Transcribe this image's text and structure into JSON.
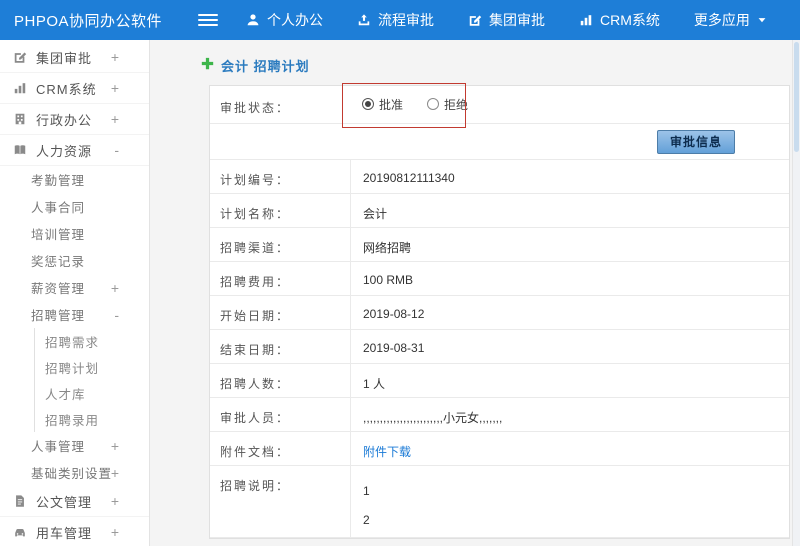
{
  "navbar": {
    "brand": "PHPOA协同办公软件",
    "menu": [
      {
        "label": "个人办公",
        "icon": "person-icon",
        "name": "personal-office"
      },
      {
        "label": "流程审批",
        "icon": "flow-icon",
        "name": "workflow-approval"
      },
      {
        "label": "集团审批",
        "icon": "edit-icon",
        "name": "group-approval"
      },
      {
        "label": "CRM系统",
        "icon": "chart-icon",
        "name": "crm-system"
      },
      {
        "label": "更多应用",
        "icon": "caret-down-icon",
        "icon_position": "after",
        "name": "more-apps"
      }
    ]
  },
  "sidebar": {
    "items": [
      {
        "label": "集团审批",
        "toggle": "+",
        "level": 0,
        "icon": "edit-icon",
        "name": "group-approval"
      },
      {
        "label": "CRM系统",
        "toggle": "+",
        "level": 0,
        "icon": "chart-icon",
        "name": "crm-system"
      },
      {
        "label": "行政办公",
        "toggle": "+",
        "level": 0,
        "icon": "building-icon",
        "name": "admin-office"
      },
      {
        "label": "人力资源",
        "toggle": "-",
        "level": 0,
        "icon": "book-icon",
        "name": "human-resources"
      },
      {
        "label": "考勤管理",
        "toggle": "",
        "level": 1,
        "name": "attendance-mgmt"
      },
      {
        "label": "人事合同",
        "toggle": "",
        "level": 1,
        "name": "hr-contracts"
      },
      {
        "label": "培训管理",
        "toggle": "",
        "level": 1,
        "name": "training-mgmt"
      },
      {
        "label": "奖惩记录",
        "toggle": "",
        "level": 1,
        "name": "reward-records"
      },
      {
        "label": "薪资管理",
        "toggle": "+",
        "level": 1,
        "name": "salary-mgmt"
      },
      {
        "label": "招聘管理",
        "toggle": "-",
        "level": 1,
        "name": "recruitment-mgmt"
      },
      {
        "label": "招聘需求",
        "toggle": "",
        "level": 2,
        "name": "recruitment-demand"
      },
      {
        "label": "招聘计划",
        "toggle": "",
        "level": 2,
        "name": "recruitment-plan"
      },
      {
        "label": "人才库",
        "toggle": "",
        "level": 2,
        "name": "talent-pool"
      },
      {
        "label": "招聘录用",
        "toggle": "",
        "level": 2,
        "name": "recruitment-hire"
      },
      {
        "label": "人事管理",
        "toggle": "+",
        "level": 1,
        "name": "personnel-mgmt"
      },
      {
        "label": "基础类别设置",
        "toggle": "+",
        "level": 1,
        "name": "base-category-settings"
      },
      {
        "label": "公文管理",
        "toggle": "+",
        "level": 0,
        "icon": "doc-icon",
        "name": "document-mgmt"
      },
      {
        "label": "用车管理",
        "toggle": "+",
        "level": 0,
        "icon": "car-icon",
        "name": "vehicle-mgmt"
      }
    ]
  },
  "breadcrumb": {
    "title": "会计 招聘计划"
  },
  "form": {
    "status_label": "审批状态：",
    "options": [
      {
        "label": "批准",
        "checked": true
      },
      {
        "label": "拒绝",
        "checked": false
      }
    ],
    "button_label": "审批信息",
    "rows": [
      {
        "label": "计划编号：",
        "value": "20190812111340"
      },
      {
        "label": "计划名称：",
        "value": "会计"
      },
      {
        "label": "招聘渠道：",
        "value": "网络招聘"
      },
      {
        "label": "招聘费用：",
        "value": "100 RMB"
      },
      {
        "label": "开始日期：",
        "value": "2019-08-12"
      },
      {
        "label": "结束日期：",
        "value": "2019-08-31"
      },
      {
        "label": "招聘人数：",
        "value": "1 人"
      },
      {
        "label": "审批人员：",
        "value": ",,,,,,,,,,,,,,,,,,,,,,,,小元女,,,,,,,"
      },
      {
        "label": "附件文档：",
        "value": "附件下载",
        "link": true
      },
      {
        "label": "招聘说明：",
        "value": "1\n2",
        "multiline": true
      }
    ]
  },
  "colors": {
    "navbar_blue": "#1e7ed7",
    "accent_blue": "#1a7ad6",
    "annotation_red": "#c23a30",
    "plus_green": "#3db54a"
  }
}
